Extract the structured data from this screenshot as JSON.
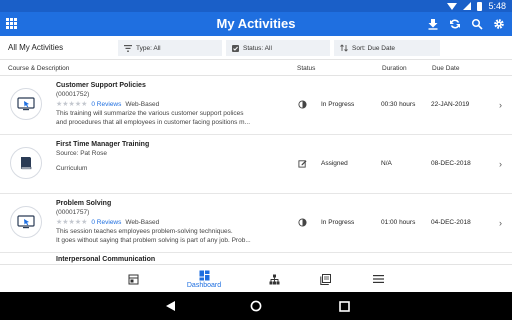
{
  "status_bar": {
    "time": "5:48",
    "icons": [
      "download-icon",
      "signal-icon",
      "battery-icon"
    ]
  },
  "app_bar": {
    "title": "My Activities",
    "icons": [
      "grid-menu-icon",
      "download-icon",
      "sync-icon",
      "search-icon",
      "gear-icon"
    ]
  },
  "filters": {
    "all_label": "All My Activities",
    "type": "Type: All",
    "status": "Status: All",
    "sort": "Sort: Due Date"
  },
  "columns": {
    "course": "Course & Description",
    "status": "Status",
    "duration": "Duration",
    "due": "Due Date"
  },
  "rows": [
    {
      "title": "Customer Support Policies",
      "id": "(00001752)",
      "stars": "★★★★★",
      "reviews": "0 Reviews",
      "type": "Web-Based",
      "desc1": "This training will summarize the various customer support polices",
      "desc2": "and procedures that all employees in customer facing positions m...",
      "status": "In Progress",
      "status_icon": "half-circle-icon",
      "duration": "00:30 hours",
      "due": "22-JAN-2019",
      "thumb_icon": "computer-training-icon"
    },
    {
      "title": "First Time Manager Training",
      "source": "Source: Pat Rose",
      "type": "Curriculum",
      "status": "Assigned",
      "status_icon": "edit-assigned-icon",
      "duration": "N/A",
      "due": "08-DEC-2018",
      "thumb_icon": "book-icon"
    },
    {
      "title": "Problem Solving",
      "id": "(00001757)",
      "stars": "★★★★★",
      "reviews": "0 Reviews",
      "type": "Web-Based",
      "desc1": "This session teaches employees problem-solving techniques.",
      "desc2": "It goes without saying that problem solving is part of any job. Prob...",
      "status": "In Progress",
      "status_icon": "half-circle-icon",
      "duration": "01:00 hours",
      "due": "04-DEC-2018",
      "thumb_icon": "computer-training-icon"
    },
    {
      "title": "Interpersonal Communication"
    }
  ],
  "bottom_nav": {
    "tabs": [
      {
        "icon": "catalog-icon",
        "label": ""
      },
      {
        "icon": "dashboard-icon",
        "label": "Dashboard"
      },
      {
        "icon": "org-chart-icon",
        "label": ""
      },
      {
        "icon": "library-icon",
        "label": ""
      },
      {
        "icon": "menu-icon",
        "label": ""
      }
    ]
  },
  "colors": {
    "primary": "#1f6fe0",
    "status_bar": "#1a5fc8",
    "filter_bg": "#eef1f5"
  }
}
